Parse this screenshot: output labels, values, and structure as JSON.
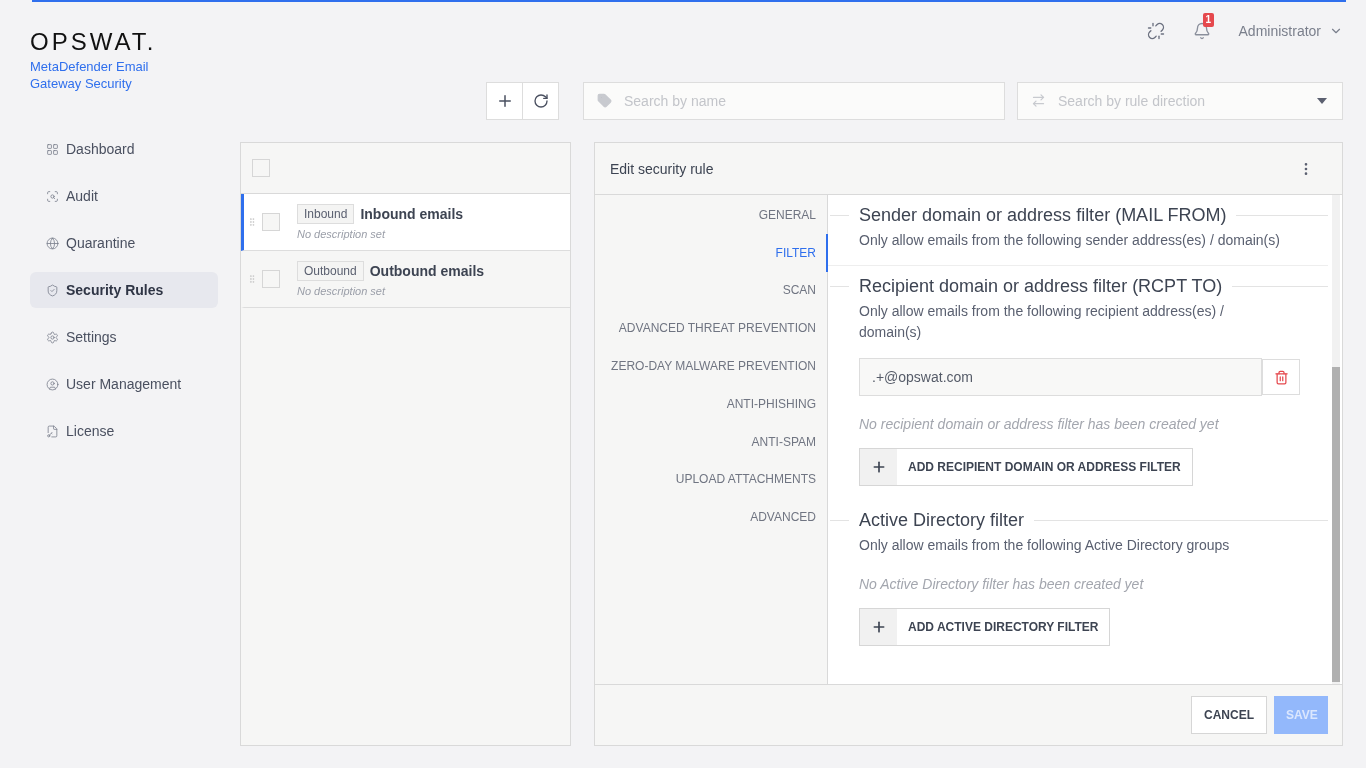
{
  "brand": {
    "logo": "OPSWAT.",
    "product": "MetaDefender Email Gateway Security"
  },
  "header": {
    "notification_count": "1",
    "user": "Administrator"
  },
  "sidebar": {
    "items": [
      {
        "label": "Dashboard",
        "selected": false
      },
      {
        "label": "Audit",
        "selected": false
      },
      {
        "label": "Quarantine",
        "selected": false
      },
      {
        "label": "Security Rules",
        "selected": true
      },
      {
        "label": "Settings",
        "selected": false
      },
      {
        "label": "User Management",
        "selected": false
      },
      {
        "label": "License",
        "selected": false
      }
    ]
  },
  "toolbar": {
    "search_name": {
      "placeholder": "Search by name"
    },
    "search_direction": {
      "placeholder": "Search by rule direction"
    }
  },
  "rule_list": {
    "select_all": {
      "checked": false
    },
    "rules": [
      {
        "tag": "Inbound",
        "name": "Inbound emails",
        "description": "No description set",
        "selected": true,
        "checked": false
      },
      {
        "tag": "Outbound",
        "name": "Outbound emails",
        "description": "No description set",
        "selected": false,
        "checked": false
      }
    ]
  },
  "editor": {
    "title": "Edit security rule",
    "tabs": [
      {
        "label": "GENERAL",
        "selected": false
      },
      {
        "label": "FILTER",
        "selected": true
      },
      {
        "label": "SCAN",
        "selected": false
      },
      {
        "label": "ADVANCED THREAT PREVENTION",
        "selected": false
      },
      {
        "label": "ZERO-DAY MALWARE PREVENTION",
        "selected": false
      },
      {
        "label": "ANTI-PHISHING",
        "selected": false
      },
      {
        "label": "ANTI-SPAM",
        "selected": false
      },
      {
        "label": "UPLOAD ATTACHMENTS",
        "selected": false
      },
      {
        "label": "ADVANCED",
        "selected": false
      }
    ],
    "sections": [
      {
        "title": "Sender domain or address filter (MAIL FROM)",
        "subtitle": "Only allow emails from the following sender address(es) / domain(s)"
      },
      {
        "title": "Recipient domain or address filter (RCPT TO)",
        "subtitle": "Only allow emails from the following recipient address(es) / domain(s)",
        "entries": [
          {
            "value": ".+@opswat.com"
          }
        ],
        "empty_text": "No recipient domain or address filter has been created yet",
        "add_button": "ADD RECIPIENT DOMAIN OR ADDRESS FILTER"
      },
      {
        "title": "Active Directory filter",
        "subtitle": "Only allow emails from the following Active Directory groups",
        "empty_text": "No Active Directory filter has been created yet",
        "add_button": "ADD ACTIVE DIRECTORY FILTER"
      }
    ],
    "cancel": "CANCEL",
    "save": {
      "label": "SAVE",
      "disabled": true
    }
  }
}
